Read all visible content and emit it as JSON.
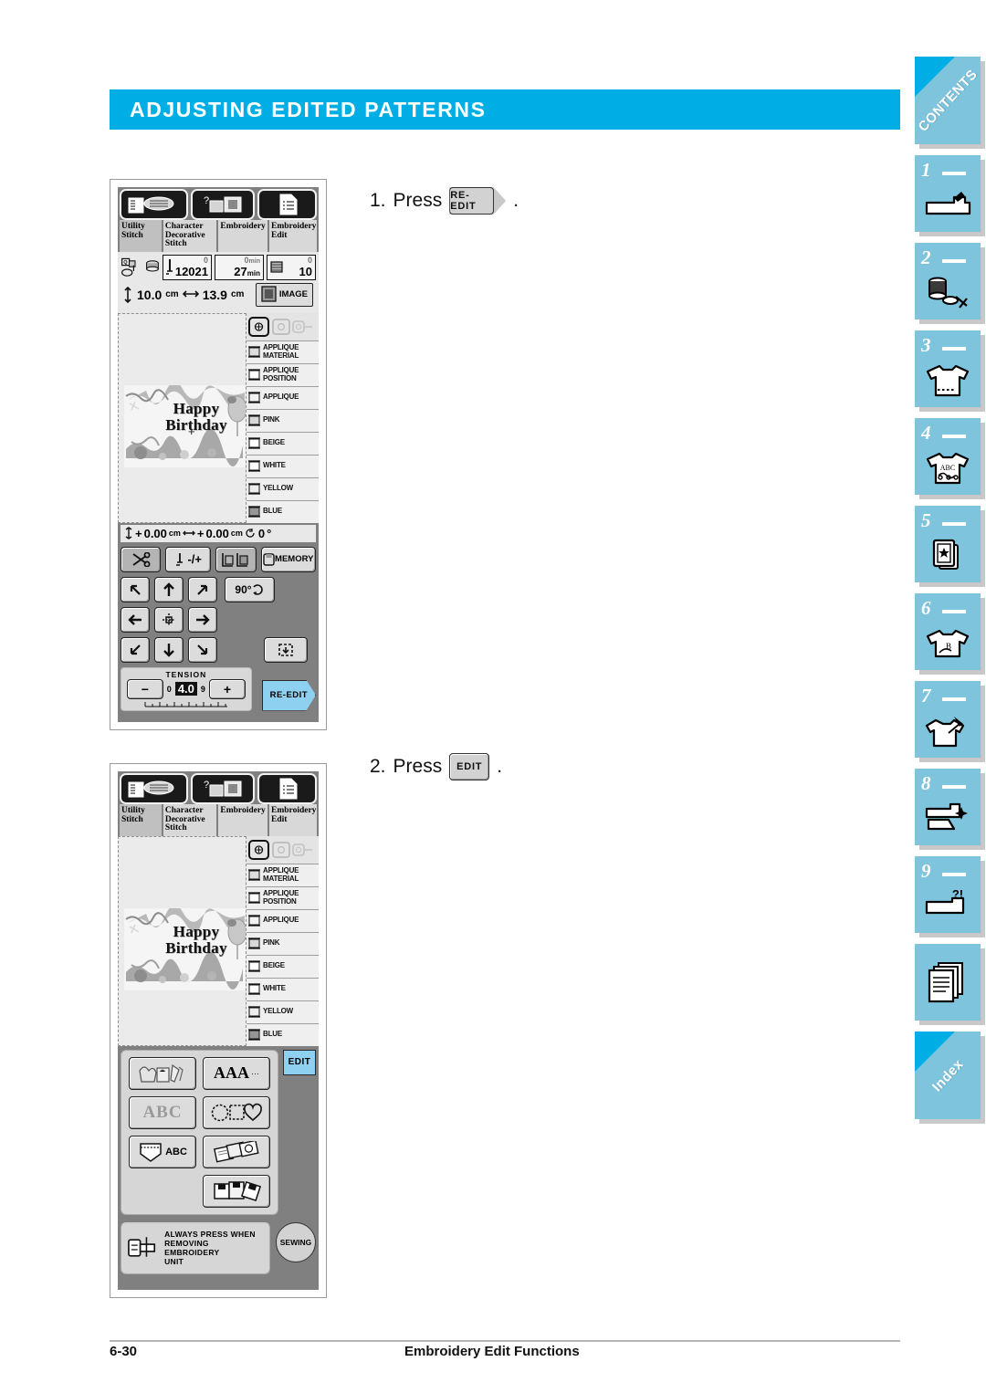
{
  "header": {
    "title": "ADJUSTING EDITED PATTERNS",
    "accent_color": "#00aee6"
  },
  "footer": {
    "page_number": "6-30",
    "section_title": "Embroidery Edit Functions"
  },
  "sidebar": {
    "tab_color": "#7ec4dd",
    "items": [
      {
        "label": "CONTENTS",
        "kind": "diagonal",
        "icon": "contents-tab"
      },
      {
        "label": "1",
        "kind": "chapter",
        "icon": "sewing-machine-icon"
      },
      {
        "label": "2",
        "kind": "chapter",
        "icon": "spool-bobbin-scissors-icon"
      },
      {
        "label": "3",
        "kind": "chapter",
        "icon": "shirt-stitch-icon"
      },
      {
        "label": "4",
        "kind": "chapter",
        "icon": "shirt-abc-icon"
      },
      {
        "label": "5",
        "kind": "chapter",
        "icon": "embroidery-card-star-icon"
      },
      {
        "label": "6",
        "kind": "chapter",
        "icon": "shirt-monogram-icon"
      },
      {
        "label": "7",
        "kind": "chapter",
        "icon": "shirt-needle-icon"
      },
      {
        "label": "8",
        "kind": "chapter",
        "icon": "machine-clean-icon"
      },
      {
        "label": "9",
        "kind": "chapter",
        "icon": "machine-question-icon"
      },
      {
        "label": "",
        "kind": "plain",
        "icon": "documents-icon"
      },
      {
        "label": "Index",
        "kind": "diagonal",
        "icon": "index-tab"
      }
    ]
  },
  "steps": [
    {
      "number": "1.",
      "verb": "Press",
      "key_label": "RE-EDIT",
      "period": ".",
      "key_style": "arrow"
    },
    {
      "number": "2.",
      "verb": "Press",
      "key_label": "EDIT",
      "period": ".",
      "key_style": "plain"
    }
  ],
  "screen": {
    "tabs": [
      {
        "label_line1": "Utility",
        "label_line2": "Stitch",
        "label_line3": "",
        "active": true
      },
      {
        "label_line1": "Character",
        "label_line2": "Decorative",
        "label_line3": "Stitch",
        "active": false
      },
      {
        "label_line1": "Embroidery",
        "label_line2": "",
        "label_line3": "",
        "active": false
      },
      {
        "label_line1": "Embroidery",
        "label_line2": "Edit",
        "label_line3": "",
        "active": false
      }
    ],
    "top_icons": [
      "book-spool-icon",
      "help-machine-icon",
      "document-list-icon"
    ],
    "counters": [
      {
        "name": "stitch-counter",
        "top": "0",
        "bottom": "12021",
        "icon": "needle-icon"
      },
      {
        "name": "time-counter",
        "top": "0",
        "top_unit": "min",
        "bottom": "27",
        "bottom_unit": "min"
      },
      {
        "name": "color-counter",
        "top": "0",
        "bottom": "10",
        "icon": "color-block-icon"
      }
    ],
    "size": {
      "height": "10.0",
      "height_unit": "cm",
      "width": "13.9",
      "width_unit": "cm"
    },
    "image_button": "IMAGE",
    "design": {
      "line1": "Happy",
      "line2": "Birthday",
      "center_mark": "+"
    },
    "color_list": [
      {
        "name": "APPLIQUE MATERIAL",
        "line1": "APPLIQUE",
        "line2": "MATERIAL",
        "swatch": "#dcdcdc"
      },
      {
        "name": "APPLIQUE POSITION",
        "line1": "APPLIQUE",
        "line2": "POSITION",
        "swatch": "#ffffff"
      },
      {
        "name": "APPLIQUE",
        "line1": "APPLIQUE",
        "line2": "",
        "swatch": "#f2f2f2"
      },
      {
        "name": "PINK",
        "line1": "PINK",
        "line2": "",
        "swatch": "#d8d8d8"
      },
      {
        "name": "BEIGE",
        "line1": "BEIGE",
        "line2": "",
        "swatch": "#ffffff"
      },
      {
        "name": "WHITE",
        "line1": "WHITE",
        "line2": "",
        "swatch": "#ffffff"
      },
      {
        "name": "YELLOW",
        "line1": "YELLOW",
        "line2": "",
        "swatch": "#ededed"
      },
      {
        "name": "BLUE",
        "line1": "BLUE",
        "line2": "",
        "swatch": "#969696"
      }
    ],
    "offsets": {
      "vertical_value": "0.00",
      "vertical_unit": "cm",
      "vertical_sign": "+",
      "horizontal_value": "0.00",
      "horizontal_unit": "cm",
      "horizontal_sign": "+",
      "rotation_value": "0",
      "rotation_unit": "°"
    },
    "tool_buttons": [
      {
        "name": "thread-cut-button",
        "icon": "scissors-icon",
        "pressed": true
      },
      {
        "name": "needle-mode-button",
        "icon": "needle-plus-minus-icon",
        "label": "-/+"
      },
      {
        "name": "basting-button",
        "icon": "frame-pair-icon",
        "pressed": true
      },
      {
        "name": "memory-button",
        "icon": "memory-icon",
        "label": "MEMORY"
      }
    ],
    "move_buttons": [
      "arrow-up-left",
      "arrow-up",
      "arrow-up-right",
      "arrow-left",
      "center-position",
      "arrow-right",
      "arrow-down-left",
      "arrow-down",
      "arrow-down-right"
    ],
    "rotate_button": {
      "label": "90°",
      "icon": "rotate-icon"
    },
    "trial_button": {
      "icon": "trace-frame-icon"
    },
    "tension": {
      "label": "TENSION",
      "value": "4.0",
      "min": "0",
      "max": "9",
      "minus": "−",
      "plus": "+"
    },
    "reedit_button": "RE-EDIT",
    "edit_button": "EDIT",
    "pattern_buttons": [
      {
        "name": "embroidery-patterns-button",
        "icon": "flower-basket-icon"
      },
      {
        "name": "font-select-button",
        "icon": "aaa-icon",
        "label": "AAA"
      },
      {
        "name": "decorative-alphabet-button",
        "icon": "abc-outline-icon",
        "label": "ABC"
      },
      {
        "name": "frame-shapes-button",
        "icon": "circle-square-heart-icon"
      },
      {
        "name": "pocket-monogram-button",
        "icon": "pocket-abc-icon",
        "label": "ABC"
      },
      {
        "name": "embroidery-cards-button",
        "icon": "cards-icon"
      },
      {
        "name": "memory-card-button",
        "icon": "floppy-disk-icon"
      }
    ],
    "warning": {
      "line1": "ALWAYS PRESS WHEN",
      "line2": "REMOVING EMBROIDERY",
      "line3": "UNIT",
      "icon": "unit-release-icon"
    },
    "sewing_button": "SEWING"
  }
}
